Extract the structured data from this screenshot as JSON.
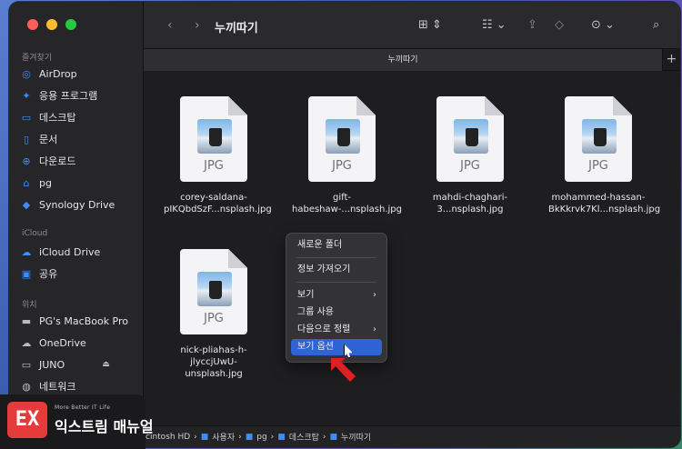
{
  "window": {
    "title": "누끼따기",
    "tab_label": "누끼따기"
  },
  "sidebar": {
    "favorites_label": "즐겨찾기",
    "favorites": [
      {
        "label": "AirDrop",
        "icon": "airdrop-icon"
      },
      {
        "label": "응용 프로그램",
        "icon": "apps-icon"
      },
      {
        "label": "데스크탑",
        "icon": "desktop-icon"
      },
      {
        "label": "문서",
        "icon": "document-icon"
      },
      {
        "label": "다운로드",
        "icon": "download-icon"
      },
      {
        "label": "pg",
        "icon": "home-icon"
      },
      {
        "label": "Synology Drive",
        "icon": "synology-icon"
      }
    ],
    "icloud_label": "iCloud",
    "icloud": [
      {
        "label": "iCloud Drive",
        "icon": "cloud-icon"
      },
      {
        "label": "공유",
        "icon": "shared-folder-icon"
      }
    ],
    "locations_label": "위치",
    "locations": [
      {
        "label": "PG's MacBook Pro",
        "icon": "laptop-icon"
      },
      {
        "label": "OneDrive",
        "icon": "cloud-icon"
      },
      {
        "label": "JUNO",
        "icon": "drive-icon"
      },
      {
        "label": "네트워크",
        "icon": "network-icon"
      }
    ]
  },
  "files": [
    {
      "name": "corey-saldana-pIKQbdSzF...nsplash.jpg",
      "ext": "JPG"
    },
    {
      "name": "gift-habeshaw-...nsplash.jpg",
      "ext": "JPG"
    },
    {
      "name": "mahdi-chaghari-3...nsplash.jpg",
      "ext": "JPG"
    },
    {
      "name": "mohammed-hassan-BkKkrvk7Kl...nsplash.jpg",
      "ext": "JPG"
    },
    {
      "name": "nick-pliahas-h-jlyccjUwU-unsplash.jpg",
      "ext": "JPG"
    }
  ],
  "context_menu": {
    "items": [
      "새로운 폴더",
      "정보 가져오기",
      "보기",
      "그룹 사용",
      "다음으로 정렬",
      "보기 옵션"
    ],
    "selected": "보기 옵션"
  },
  "pathbar": {
    "segments": [
      "cintosh HD",
      "사용자",
      "pg",
      "데스크탑",
      "누끼따기"
    ]
  },
  "brand": {
    "logo_text": "EX",
    "tagline": "More Better IT Life",
    "name": "익스트림 매뉴얼"
  },
  "colors": {
    "accent": "#2f63d8",
    "folder": "#3d8dff",
    "arrow": "#e02020",
    "brand": "#e63b3b"
  }
}
